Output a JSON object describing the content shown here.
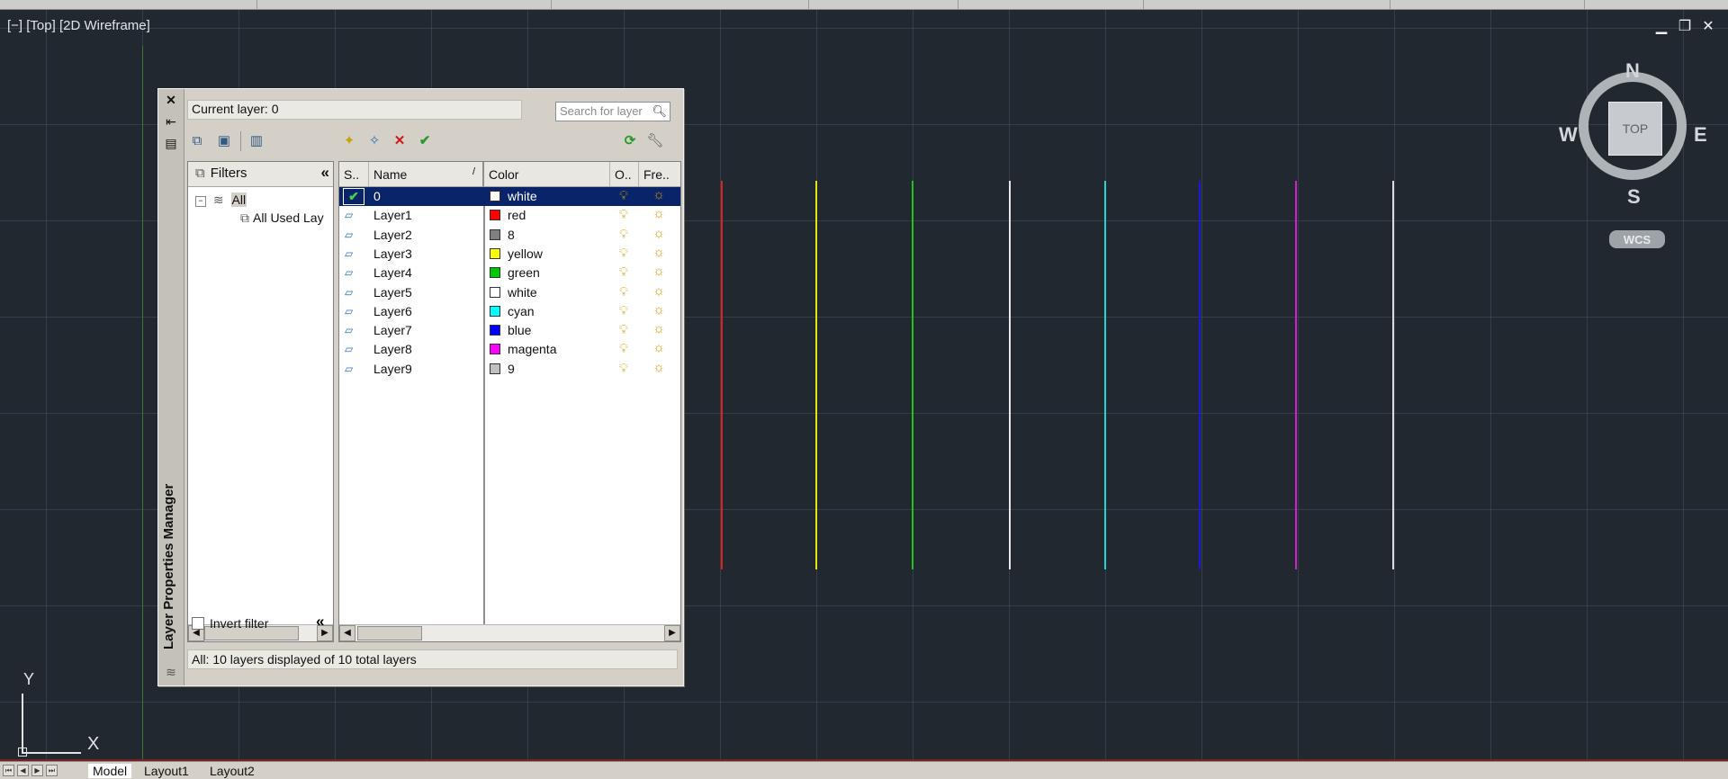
{
  "viewport": {
    "label": "[−] [Top] [2D Wireframe]",
    "window_controls": [
      "minimize-icon",
      "restore-icon",
      "close-icon"
    ]
  },
  "viewcube": {
    "face": "TOP",
    "north": "N",
    "south": "S",
    "east": "E",
    "west": "W",
    "wcs": "WCS"
  },
  "ucs": {
    "x": "X",
    "y": "Y"
  },
  "drawing_lines": [
    {
      "color": "#e01f1f"
    },
    {
      "color": "#e6e600"
    },
    {
      "color": "#1fc21f"
    },
    {
      "color": "#e6e6e6"
    },
    {
      "color": "#1fd5d5"
    },
    {
      "color": "#1a1ad8"
    },
    {
      "color": "#d21fd2"
    },
    {
      "color": "#dcdcdc"
    }
  ],
  "layer_manager": {
    "title": "Layer Properties Manager",
    "current_layer": "Current layer: 0",
    "search_placeholder": "Search for layer",
    "filters": {
      "header": "Filters",
      "all": "All",
      "all_used": "All Used Lay",
      "invert_label": "Invert filter"
    },
    "columns": {
      "status": "S..",
      "name": "Name",
      "color": "Color",
      "on": "O..",
      "freeze": "Fre.."
    },
    "layers": [
      {
        "name": "0",
        "color_name": "white",
        "swatch": "#ffffff",
        "current": true
      },
      {
        "name": "Layer1",
        "color_name": "red",
        "swatch": "#ff0000"
      },
      {
        "name": "Layer2",
        "color_name": "8",
        "swatch": "#808080"
      },
      {
        "name": "Layer3",
        "color_name": "yellow",
        "swatch": "#ffff00"
      },
      {
        "name": "Layer4",
        "color_name": "green",
        "swatch": "#00c800"
      },
      {
        "name": "Layer5",
        "color_name": "white",
        "swatch": "#ffffff"
      },
      {
        "name": "Layer6",
        "color_name": "cyan",
        "swatch": "#00ffff"
      },
      {
        "name": "Layer7",
        "color_name": "blue",
        "swatch": "#0000ff"
      },
      {
        "name": "Layer8",
        "color_name": "magenta",
        "swatch": "#ff00ff"
      },
      {
        "name": "Layer9",
        "color_name": "9",
        "swatch": "#c0c0c0"
      }
    ],
    "status_text": "All: 10 layers displayed of 10 total layers"
  },
  "tabs": [
    "Model",
    "Layout1",
    "Layout2"
  ]
}
